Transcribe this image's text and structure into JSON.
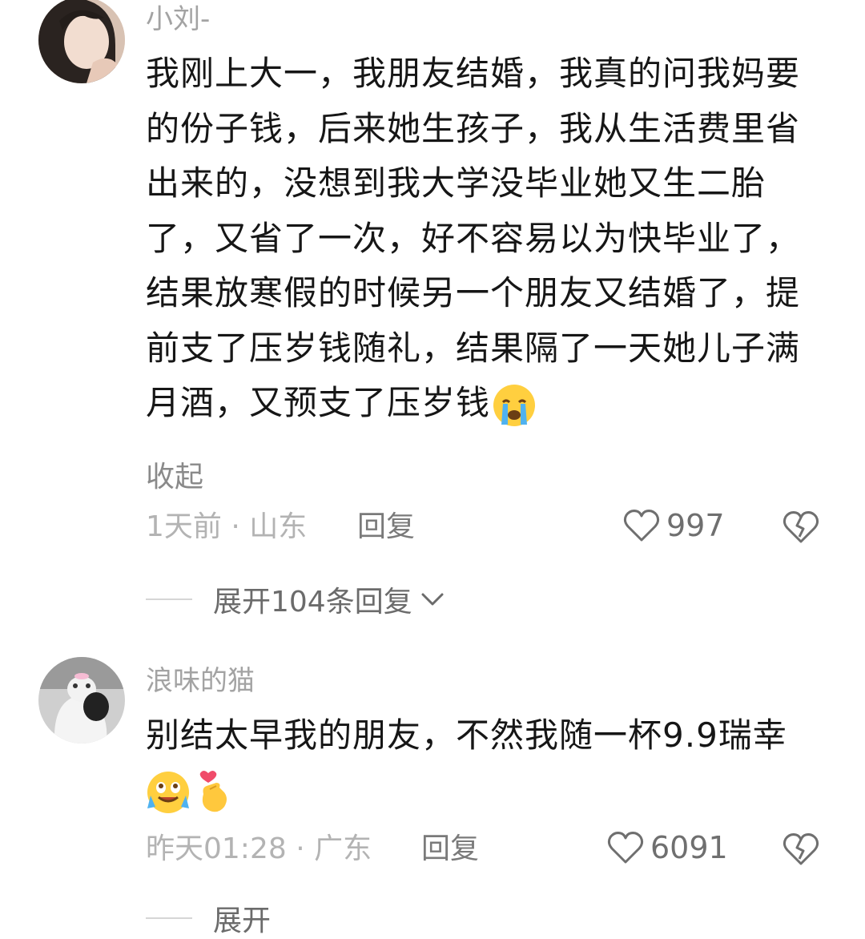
{
  "comments": [
    {
      "username": "小刘-",
      "text": "我刚上大一，我朋友结婚，我真的问我妈要的份子钱，后来她生孩子，我从生活费里省出来的，没想到我大学没毕业她又生二胎了，又省了一次，好不容易以为快毕业了，结果放寒假的时候另一个朋友又结婚了，提前支了压岁钱随礼，结果隔了一天她儿子满月酒，又预支了压岁钱",
      "collapse_label": "收起",
      "time_location": "1天前 · 山东",
      "reply_label": "回复",
      "like_count": "997",
      "expand_label": "展开104条回复",
      "emojis": [
        "crying-face-emoji"
      ]
    },
    {
      "username": "浪味的猫",
      "text": "别结太早我的朋友，不然我随一杯9.9瑞幸",
      "time_location": "昨天01:28 · 广东",
      "reply_label": "回复",
      "like_count": "6091",
      "expand_label": "展开",
      "emojis": [
        "tearful-smile-emoji",
        "finger-heart-emoji"
      ]
    }
  ]
}
